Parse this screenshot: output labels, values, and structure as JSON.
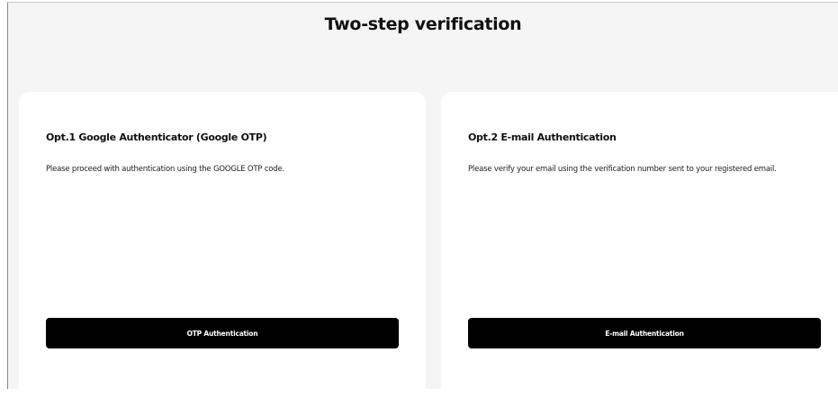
{
  "header": {
    "title": "Two-step verification"
  },
  "options": [
    {
      "title": "Opt.1 Google Authenticator (Google OTP)",
      "description": "Please proceed with authentication using the GOOGLE OTP code.",
      "button_label": "OTP Authentication"
    },
    {
      "title": "Opt.2 E-mail Authentication",
      "description": "Please verify your email using the verification number sent to your registered email.",
      "button_label": "E-mail Authentication"
    }
  ],
  "colors": {
    "background": "#f5f5f5",
    "card": "#ffffff",
    "button": "#000000",
    "button_text": "#ffffff",
    "text": "#111111"
  }
}
